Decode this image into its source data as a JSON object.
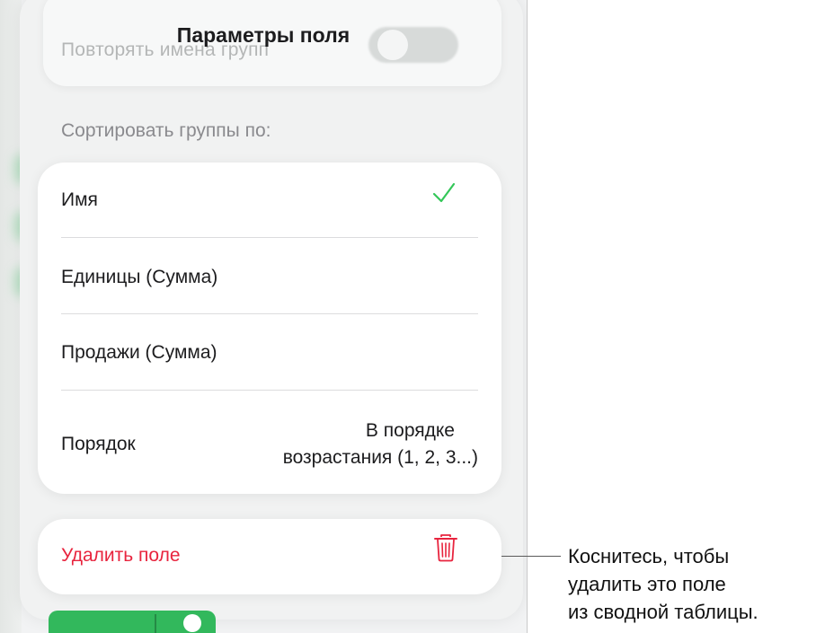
{
  "sheet": {
    "title": "Параметры поля",
    "repeat_group_names_label": "Повторять имена групп",
    "sort_section_label": "Сортировать группы по:"
  },
  "sort_options": [
    {
      "label": "Имя",
      "selected": true
    },
    {
      "label": "Единицы (Сумма)",
      "selected": false
    },
    {
      "label": "Продажи (Сумма)",
      "selected": false
    }
  ],
  "order_row": {
    "label": "Порядок",
    "value_line1": "В порядке",
    "value_line2": "возрастания (1, 2, 3...)"
  },
  "delete": {
    "label": "Удалить поле",
    "icon": "trash-icon"
  },
  "callout": {
    "line1": "Коснитесь, чтобы",
    "line2": "удалить это поле",
    "line3": "из сводной таблицы."
  },
  "colors": {
    "accent_green": "#34c759",
    "destructive_red": "#e8243e"
  }
}
